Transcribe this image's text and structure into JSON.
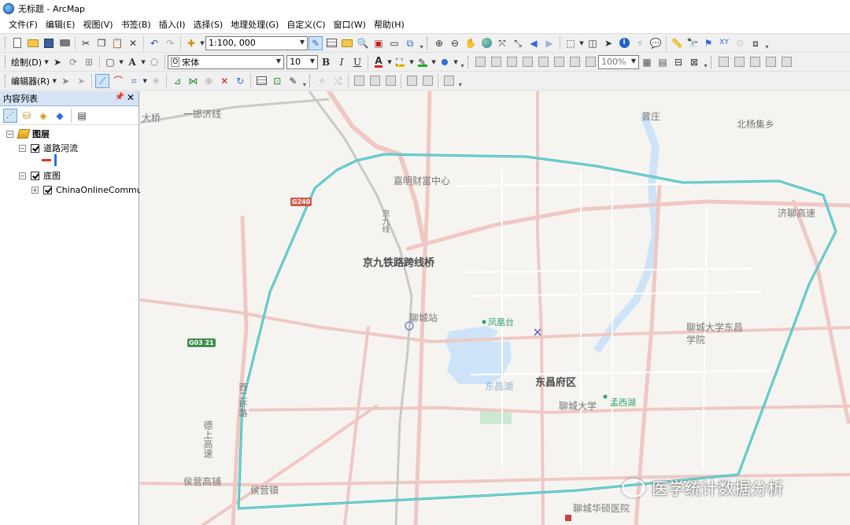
{
  "window": {
    "title": "无标题 - ArcMap"
  },
  "menu": [
    "文件(F)",
    "编辑(E)",
    "视图(V)",
    "书签(B)",
    "插入(I)",
    "选择(S)",
    "地理处理(G)",
    "自定义(C)",
    "窗口(W)",
    "帮助(H)"
  ],
  "toolbar1": {
    "scale": "1:100, 000"
  },
  "toolbar2": {
    "draw_label": "绘制(D)",
    "font_name": "宋体",
    "font_size": "10",
    "bold": "B",
    "italic": "I",
    "underline": "U",
    "zoom_percent": "100%"
  },
  "toolbar3": {
    "editor_label": "编辑器(R)"
  },
  "toc": {
    "title": "内容列表",
    "items": [
      {
        "label": "图层"
      },
      {
        "label": "道路河流"
      },
      {
        "label": "底图"
      },
      {
        "label": "ChinaOnlineCommu"
      }
    ]
  },
  "map": {
    "labels": {
      "l1": "大桥",
      "l2": "一邯济线",
      "l3": "曾庄",
      "l4": "北杨集乡",
      "l5": "嘉明财富中心",
      "l6": "京九铁路跨线桥",
      "l7": "济聊高速",
      "l8": "聊城站",
      "l9": "凤凰台",
      "l10": "聊城大学东昌",
      "l11": "学院",
      "l12": "东昌湖",
      "l13": "东昌府区",
      "l14": "聊城大学",
      "l15": "孟西湖",
      "l16": "德上高速",
      "l17": "侯营高铺",
      "l18": "侯营镇",
      "l19": "聊城华硕医院",
      "l20": "西二环路",
      "l21": "京九线"
    },
    "shields": {
      "s1": "G240",
      "s2": "G03 21"
    },
    "watermark": "医学统计数据分析"
  },
  "colors": {
    "boundary": "#3dbdbd",
    "road": "#efc8c4",
    "water": "#cde4f8"
  }
}
